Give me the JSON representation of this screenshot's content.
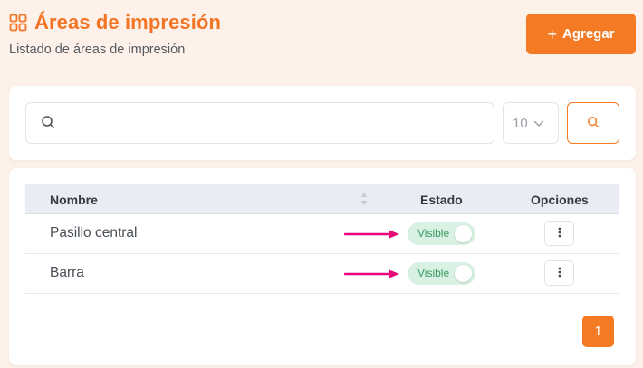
{
  "header": {
    "title": "Áreas de impresión",
    "subtitle": "Listado de áreas de impresión",
    "title_icon": "grid-icon",
    "add_button": {
      "icon": "+",
      "label": "Agregar"
    }
  },
  "search": {
    "placeholder": "",
    "value": "",
    "icon": "search-icon",
    "per_page": "10",
    "search_button_icon": "search-icon"
  },
  "table": {
    "columns": [
      "Nombre",
      "Estado",
      "Opciones"
    ],
    "rows": [
      {
        "name": "Pasillo central",
        "status": "Visible",
        "visible": true
      },
      {
        "name": "Barra",
        "status": "Visible",
        "visible": true
      }
    ],
    "options_icon": "kebab-menu-icon"
  },
  "pagination": {
    "current": "1"
  },
  "colors": {
    "accent": "#f47a24",
    "background": "#fdf1ea",
    "toggle_bg": "#d8f1e2",
    "toggle_text": "#3a9a62",
    "annotation_arrow": "#e8087a"
  }
}
